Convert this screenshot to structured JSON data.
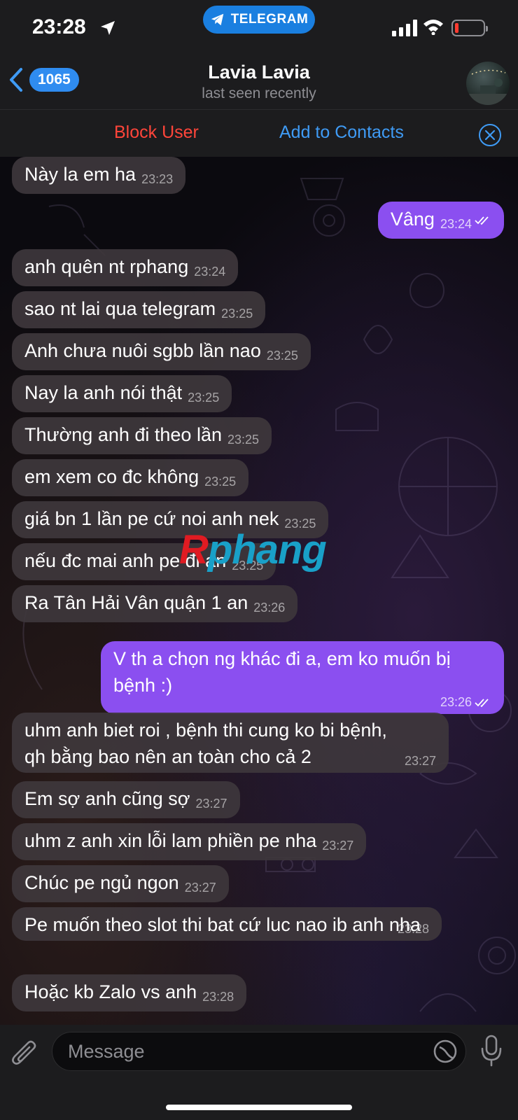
{
  "status_bar": {
    "time": "23:28",
    "app_pill": "TELEGRAM"
  },
  "header": {
    "back_count": "1065",
    "title": "Lavia Lavia",
    "subtitle": "last seen recently"
  },
  "actions": {
    "block_user": "Block User",
    "add_to_contacts": "Add to Contacts"
  },
  "messages": [
    {
      "dir": "in",
      "text": "Này la em ha",
      "time": "23:23"
    },
    {
      "dir": "out",
      "text": "Vâng",
      "time": "23:24",
      "read": true
    },
    {
      "dir": "in",
      "text": "anh quên nt rphang",
      "time": "23:24"
    },
    {
      "dir": "in",
      "text": "sao nt lai qua telegram",
      "time": "23:25"
    },
    {
      "dir": "in",
      "text": "Anh chưa nuôi sgbb lần nao",
      "time": "23:25"
    },
    {
      "dir": "in",
      "text": "Nay la anh nói thật",
      "time": "23:25"
    },
    {
      "dir": "in",
      "text": "Thường anh đi theo lần",
      "time": "23:25"
    },
    {
      "dir": "in",
      "text": "em xem co đc không",
      "time": "23:25"
    },
    {
      "dir": "in",
      "text": "giá bn 1 lần pe cứ noi anh nek",
      "time": "23:25"
    },
    {
      "dir": "in",
      "text": "nếu đc mai anh pe đi an",
      "time": "23:25"
    },
    {
      "dir": "in",
      "text": "Ra Tân Hải Vân quận 1 an",
      "time": "23:26"
    },
    {
      "dir": "out",
      "text": "V th a chọn ng khác đi a, em ko muốn bị bệnh :)",
      "time": "23:26",
      "read": true
    },
    {
      "dir": "in",
      "text": "uhm anh biet roi , bệnh thi cung ko bi bệnh, qh bằng bao nên an toàn cho cả 2",
      "time": "23:27"
    },
    {
      "dir": "in",
      "text": "Em sợ anh cũng sợ",
      "time": "23:27"
    },
    {
      "dir": "in",
      "text": "uhm z anh xin lỗi lam phiền pe nha",
      "time": "23:27"
    },
    {
      "dir": "in",
      "text": "Chúc pe ngủ ngon",
      "time": "23:27"
    },
    {
      "dir": "in",
      "text": "Pe muốn theo slot thi bat cứ luc nao ib anh nha",
      "time": "23:28"
    },
    {
      "dir": "in",
      "text": "Hoặc kb Zalo vs anh",
      "time": "23:28"
    }
  ],
  "watermark": {
    "first": "R",
    "rest": "phang"
  },
  "composer": {
    "placeholder": "Message"
  }
}
